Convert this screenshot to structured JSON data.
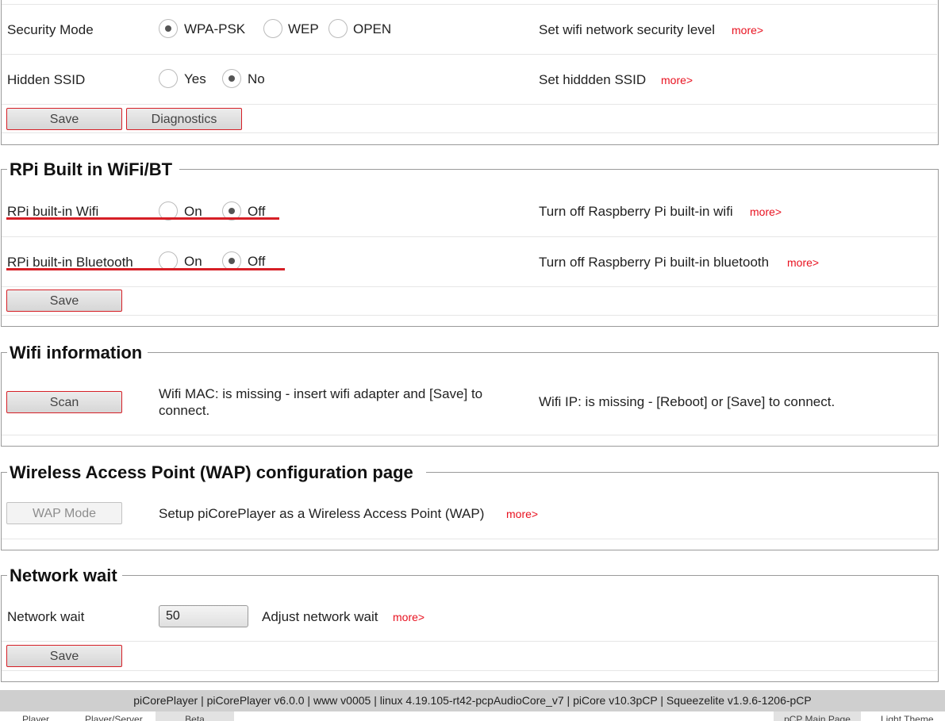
{
  "security": {
    "label": "Security Mode",
    "options": [
      "WPA-PSK",
      "WEP",
      "OPEN"
    ],
    "selected": "WPA-PSK",
    "help": "Set wifi network security level",
    "more": "more>"
  },
  "hidden_ssid": {
    "label": "Hidden SSID",
    "options": [
      "Yes",
      "No"
    ],
    "selected": "No",
    "help": "Set hiddden SSID",
    "more": "more>"
  },
  "wifi_buttons": {
    "save": "Save",
    "diagnostics": "Diagnostics"
  },
  "rpi": {
    "title": "RPi Built in WiFi/BT",
    "wifi": {
      "label": "RPi built-in Wifi",
      "on": "On",
      "off": "Off",
      "selected": "Off",
      "help": "Turn off Raspberry Pi built-in wifi",
      "more": "more>"
    },
    "bt": {
      "label": "RPi built-in Bluetooth",
      "on": "On",
      "off": "Off",
      "selected": "Off",
      "help": "Turn off Raspberry Pi built-in bluetooth",
      "more": "more>"
    },
    "save": "Save"
  },
  "wifi_info": {
    "title": "Wifi information",
    "scan": "Scan",
    "mac_line1": "Wifi MAC: is missing - insert wifi adapter and [Save] to",
    "mac_line2": "connect.",
    "ip": "Wifi IP: is missing - [Reboot] or [Save] to connect."
  },
  "wap": {
    "title": "Wireless Access Point (WAP) configuration page",
    "button": "WAP Mode",
    "help": "Setup piCorePlayer as a Wireless Access Point (WAP)",
    "more": "more>"
  },
  "network_wait": {
    "title": "Network wait",
    "label": "Network wait",
    "value": "50",
    "help": "Adjust network wait",
    "more": "more>",
    "save": "Save"
  },
  "footer": {
    "text": "piCorePlayer | piCorePlayer v6.0.0 | www v0005 | linux 4.19.105-rt42-pcpAudioCore_v7 | piCore v10.3pCP | Squeezelite v1.9.6-1206-pCP"
  },
  "tabs": [
    "Player",
    "Player/Server",
    "Beta",
    "pCP Main Page",
    "Light Theme"
  ]
}
